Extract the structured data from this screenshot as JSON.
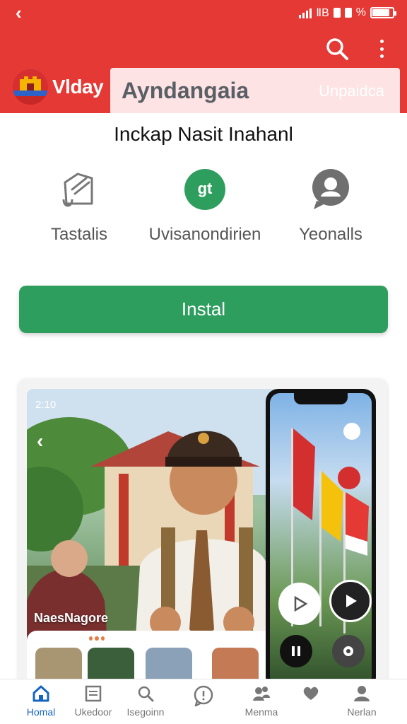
{
  "status_bar": {
    "network_text": "ⅡB",
    "battery_percent_text": "%",
    "battery_level": 0.85
  },
  "header": {
    "brand_name": "Vlday",
    "active_tab": "Ayndangaia",
    "other_tab": "Unpaidca"
  },
  "headline": "Inckap Nasit Inahanl",
  "features": [
    {
      "label": "Tastalis",
      "icon": "document-edit-icon"
    },
    {
      "label": "Uvisanondirien",
      "icon": "green-badge-icon",
      "badge_text": "gt"
    },
    {
      "label": "Yeonalls",
      "icon": "chat-user-icon"
    }
  ],
  "install_button": {
    "label": "Instal"
  },
  "preview": {
    "time": "2:10",
    "caption": "NaesNagore"
  },
  "bottom_nav": [
    {
      "label": "Homal",
      "icon": "home-icon",
      "active": true
    },
    {
      "label": "Ukedoor",
      "icon": "list-icon",
      "active": false
    },
    {
      "label": "Isegoinn",
      "icon": "search-icon",
      "active": false
    },
    {
      "label": "",
      "icon": "chat-bubble-icon",
      "active": false
    },
    {
      "label": "Menma",
      "icon": "people-icon",
      "active": false
    },
    {
      "label": "",
      "icon": "heart-icon",
      "active": false
    },
    {
      "label": "Nerlan",
      "icon": "person-icon",
      "active": false
    }
  ],
  "colors": {
    "header_red": "#e53935",
    "install_green": "#2e9e5e",
    "nav_active_blue": "#1565c0"
  }
}
